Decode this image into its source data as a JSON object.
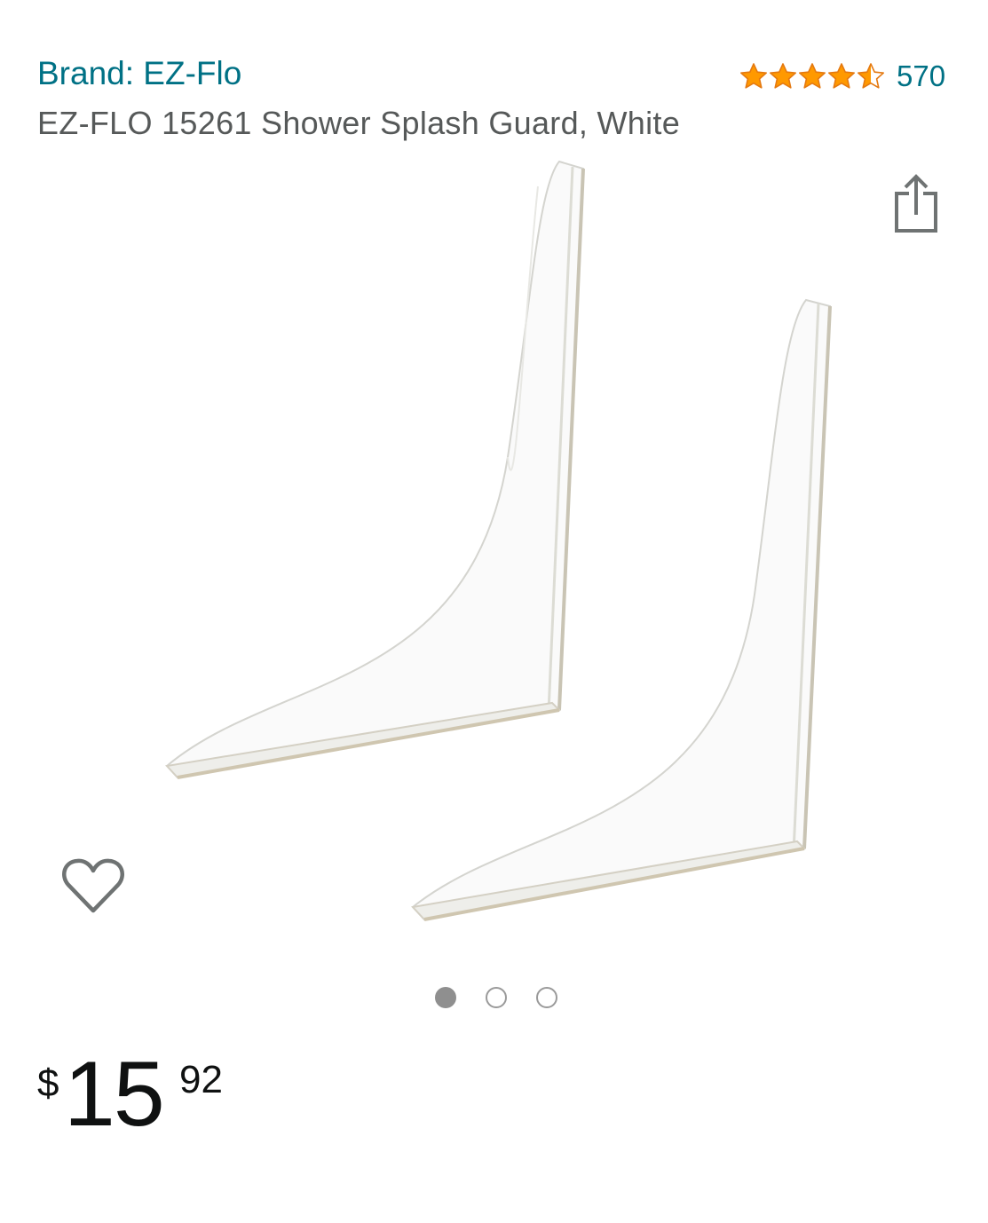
{
  "header": {
    "brand_link": "Brand: EZ-Flo",
    "title": "EZ-FLO 15261 Shower Splash Guard, White"
  },
  "rating": {
    "stars": 4.5,
    "max_stars": 5,
    "count": "570",
    "star_color": "#ff9900",
    "star_outline": "#e47911"
  },
  "gallery": {
    "image_alt": "EZ-FLO 15261 Shower Splash Guard, White",
    "image_count": 3,
    "active_index": 0,
    "share_icon": "share-icon",
    "wishlist_icon": "heart-icon"
  },
  "price": {
    "symbol": "$",
    "whole": "15",
    "fraction": "92"
  },
  "colors": {
    "link": "#007185",
    "text": "#565959",
    "price": "#0f1111"
  }
}
